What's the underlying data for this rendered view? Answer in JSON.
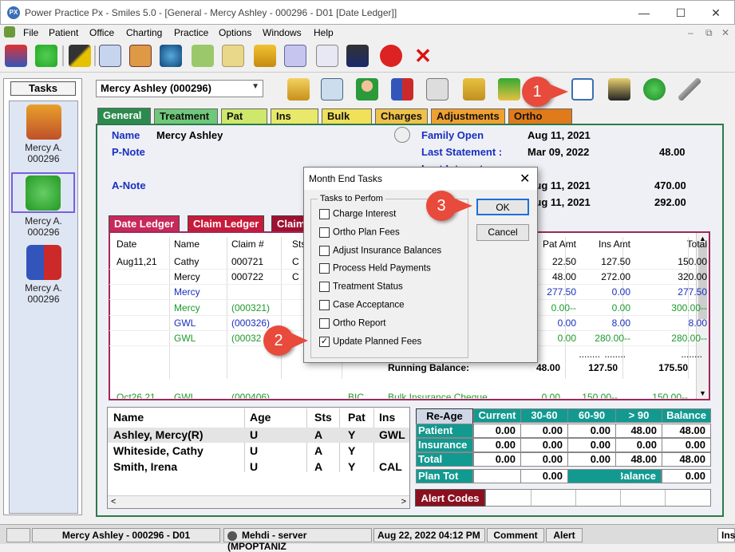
{
  "window": {
    "title": "Power Practice Px - Smiles 5.0 - [General - Mercy Ashley - 000296 - D01 [Date Ledger]]",
    "app_icon": "PX",
    "minimize": "—",
    "maximize": "☐",
    "close": "✕"
  },
  "menu": [
    "File",
    "Patient",
    "Office",
    "Charting",
    "Practice",
    "Options",
    "Windows",
    "Help"
  ],
  "tasks": {
    "title": "Tasks",
    "items": [
      {
        "name": "Mercy A.",
        "id": "000296",
        "icon": "chart-icon"
      },
      {
        "name": "Mercy A.",
        "id": "000296",
        "icon": "dollar-arrow-icon"
      },
      {
        "name": "Mercy A.",
        "id": "000296",
        "icon": "family-icon"
      }
    ]
  },
  "patient_select": "Mercy Ashley (000296)",
  "tabs": [
    {
      "label": "General",
      "color": "#2d8a4e"
    },
    {
      "label": "Treatment",
      "color": "#6fc87a"
    },
    {
      "label": "Pat Pmt",
      "color": "#cde86a"
    },
    {
      "label": "Ins Pmt",
      "color": "#e8e86a"
    },
    {
      "label": "Bulk Ins",
      "color": "#f0e05a"
    },
    {
      "label": "Charges",
      "color": "#f0c24a"
    },
    {
      "label": "Adjustments",
      "color": "#f0a030"
    },
    {
      "label": "Ortho Plan",
      "color": "#e07a1a"
    }
  ],
  "general": {
    "name_label": "Name",
    "name_value": "Mercy Ashley",
    "pnote_label": "P-Note",
    "anote_label": "A-Note",
    "family_open_label": "Family Open",
    "family_open_value": "Aug 11, 2021",
    "last_statement_label": "Last Statement :",
    "last_statement_date": "Mar 09, 2022",
    "last_statement_amount": "48.00",
    "last_interest_label": "Last Interest :",
    "row3_date": "Aug 11, 2021",
    "row3_amount": "470.00",
    "row4_date": "Aug 11, 2021",
    "row4_amount": "292.00"
  },
  "subtabs": [
    "Date Ledger",
    "Claim Ledger",
    "Claim"
  ],
  "ledger": {
    "headers": [
      "Date",
      "Name",
      "Claim #",
      "Sts",
      "Pat Amt",
      "Ins Amt",
      "Total"
    ],
    "rows": [
      {
        "date": "Aug11,21",
        "name": "Cathy",
        "claim": "000721",
        "sts": "C",
        "pat": "22.50",
        "ins": "127.50",
        "total": "150.00",
        "color": "#000"
      },
      {
        "date": "",
        "name": "Mercy",
        "claim": "000722",
        "sts": "C",
        "pat": "48.00",
        "ins": "272.00",
        "total": "320.00",
        "color": "#000"
      },
      {
        "date": "",
        "name": "Mercy",
        "claim": "",
        "sts": "",
        "pat": "277.50",
        "ins": "0.00",
        "total": "277.50",
        "color": "#1a2fbf"
      },
      {
        "date": "",
        "name": "Mercy",
        "claim": "(000321)",
        "sts": "",
        "pat": "0.00--",
        "ins": "0.00",
        "total": "300.00--",
        "color": "#1a9a2a"
      },
      {
        "date": "",
        "name": "GWL",
        "claim": "(000326)",
        "sts": "",
        "pat": "0.00",
        "ins": "8.00",
        "total": "8.00",
        "color": "#1a2fbf"
      },
      {
        "date": "",
        "name": "GWL",
        "claim": "(00032",
        "sts": "",
        "pat": "0.00",
        "ins": "280.00--",
        "total": "280.00--",
        "color": "#1a9a2a"
      }
    ],
    "dashes": "........",
    "running_label": "Running Balance:",
    "running_pat": "48.00",
    "running_ins": "127.50",
    "running_total": "175.50",
    "last_row": {
      "date": "Oct26,21",
      "name": "GWL",
      "claim": "(000406)",
      "sts": "BIC",
      "desc": "Bulk Insurance Cheque",
      "pat": "0.00",
      "ins": "150.00--",
      "total": "150.00--"
    }
  },
  "patients": {
    "headers": [
      "Name",
      "Age",
      "Sts",
      "Pat",
      "Ins"
    ],
    "rows": [
      [
        "Ashley, Mercy(R)",
        "U",
        "A",
        "Y",
        "GWL"
      ],
      [
        "Whiteside, Cathy",
        "U",
        "A",
        "Y",
        ""
      ],
      [
        "Smith, Irena",
        "U",
        "A",
        "Y",
        "CAL"
      ]
    ]
  },
  "aging": {
    "reage": "Re-Age",
    "headers": [
      "Current",
      "30-60",
      "60-90",
      "> 90",
      "Balance"
    ],
    "rows": [
      {
        "label": "Patient",
        "values": [
          "0.00",
          "0.00",
          "0.00",
          "48.00",
          "48.00"
        ]
      },
      {
        "label": "Insurance",
        "values": [
          "0.00",
          "0.00",
          "0.00",
          "0.00",
          "0.00"
        ]
      },
      {
        "label": "Total",
        "values": [
          "0.00",
          "0.00",
          "0.00",
          "48.00",
          "48.00"
        ]
      }
    ],
    "plan_tot_label": "Plan Tot",
    "plan_tot_value": "0.00",
    "balance_label": "Balance",
    "balance_value": "0.00"
  },
  "alert_codes": "Alert Codes",
  "statusbar": {
    "patient": "Mercy Ashley - 000296 - D01",
    "user": "Mehdi - server (MPOPTANIZ",
    "datetime": "Aug 22, 2022 04:12 PM",
    "comment": "Comment",
    "alert": "Alert",
    "ins": "Ins"
  },
  "dialog": {
    "title": "Month End Tasks",
    "close": "✕",
    "group_label": "Tasks to Perfom",
    "tasks": [
      {
        "label": "Charge Interest",
        "checked": false
      },
      {
        "label": "Ortho Plan Fees",
        "checked": false
      },
      {
        "label": "Adjust Insurance Balances",
        "checked": false
      },
      {
        "label": "Process Held Payments",
        "checked": false
      },
      {
        "label": "Treatment Status",
        "checked": false
      },
      {
        "label": "Case Acceptance",
        "checked": false
      },
      {
        "label": "Ortho Report",
        "checked": false
      },
      {
        "label": "Update Planned Fees",
        "checked": true
      }
    ],
    "ok": "OK",
    "cancel": "Cancel",
    "check_mark": "✓"
  },
  "callouts": [
    "1",
    "2",
    "3"
  ],
  "colors": {
    "callout": "#e84a3c",
    "teal": "#129a91",
    "ledger_border": "#a0285a"
  }
}
